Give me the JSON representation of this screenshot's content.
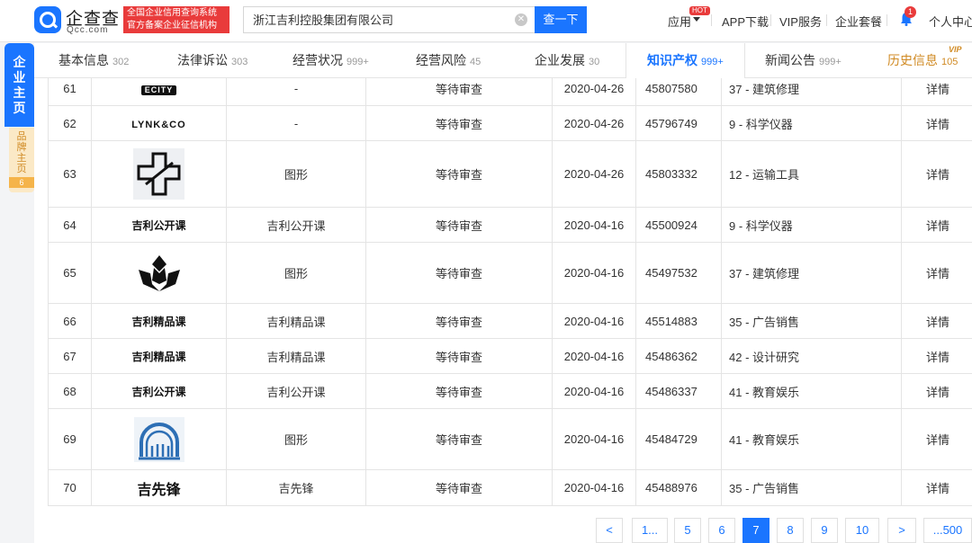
{
  "header": {
    "logo_name": "企查查",
    "logo_domain": "Qcc.com",
    "slogan_line1": "全国企业信用查询系统",
    "slogan_line2": "官方备案企业征信机构",
    "search_value": "浙江吉利控股集团有限公司",
    "search_button": "查一下",
    "nav": {
      "apps": "应用",
      "hot": "HOT",
      "app_download": "APP下载",
      "vip": "VIP服务",
      "enterprise": "企业套餐",
      "notify_count": "1",
      "personal": "个人中心"
    }
  },
  "side": {
    "main": [
      "企",
      "业",
      "主",
      "页"
    ],
    "brand": [
      "品",
      "牌",
      "主",
      "页"
    ],
    "brand_count": "6"
  },
  "tabs": [
    {
      "label": "基本信息",
      "count": "302"
    },
    {
      "label": "法律诉讼",
      "count": "303"
    },
    {
      "label": "经营状况",
      "count": "999+"
    },
    {
      "label": "经营风险",
      "count": "45"
    },
    {
      "label": "企业发展",
      "count": "30"
    },
    {
      "label": "知识产权",
      "count": "999+"
    },
    {
      "label": "新闻公告",
      "count": "999+"
    },
    {
      "label": "历史信息",
      "count": "105"
    }
  ],
  "vip_tag": "VIP",
  "rows": [
    {
      "no": "61",
      "logo": "ECITY",
      "name": "-",
      "status": "等待审查",
      "date": "2020-04-26",
      "reg": "45807580",
      "class": "37 - 建筑修理",
      "detail": "详情"
    },
    {
      "no": "62",
      "logo": "LYNK&CO",
      "name": "-",
      "status": "等待审查",
      "date": "2020-04-26",
      "reg": "45796749",
      "class": "9 - 科学仪器",
      "detail": "详情"
    },
    {
      "no": "63",
      "logo": "",
      "name": "图形",
      "status": "等待审查",
      "date": "2020-04-26",
      "reg": "45803332",
      "class": "12 - 运输工具",
      "detail": "详情"
    },
    {
      "no": "64",
      "logo": "吉利公开课",
      "name": "吉利公开课",
      "status": "等待审查",
      "date": "2020-04-16",
      "reg": "45500924",
      "class": "9 - 科学仪器",
      "detail": "详情"
    },
    {
      "no": "65",
      "logo": "",
      "name": "图形",
      "status": "等待审查",
      "date": "2020-04-16",
      "reg": "45497532",
      "class": "37 - 建筑修理",
      "detail": "详情"
    },
    {
      "no": "66",
      "logo": "吉利精品课",
      "name": "吉利精品课",
      "status": "等待审查",
      "date": "2020-04-16",
      "reg": "45514883",
      "class": "35 - 广告销售",
      "detail": "详情"
    },
    {
      "no": "67",
      "logo": "吉利精品课",
      "name": "吉利精品课",
      "status": "等待审查",
      "date": "2020-04-16",
      "reg": "45486362",
      "class": "42 - 设计研究",
      "detail": "详情"
    },
    {
      "no": "68",
      "logo": "吉利公开课",
      "name": "吉利公开课",
      "status": "等待审查",
      "date": "2020-04-16",
      "reg": "45486337",
      "class": "41 - 教育娱乐",
      "detail": "详情"
    },
    {
      "no": "69",
      "logo": "",
      "name": "图形",
      "status": "等待审查",
      "date": "2020-04-16",
      "reg": "45484729",
      "class": "41 - 教育娱乐",
      "detail": "详情"
    },
    {
      "no": "70",
      "logo": "吉先锋",
      "name": "吉先锋",
      "status": "等待审查",
      "date": "2020-04-16",
      "reg": "45488976",
      "class": "35 - 广告销售",
      "detail": "详情"
    }
  ],
  "pagination": {
    "prev": "<",
    "first": "1...",
    "pages": [
      "5",
      "6",
      "7",
      "8",
      "9",
      "10"
    ],
    "current": "7",
    "next": ">",
    "last": "...500"
  },
  "colors": {
    "accent": "#1a75ff",
    "hot": "#e93b3b",
    "vip": "#d08a23"
  }
}
